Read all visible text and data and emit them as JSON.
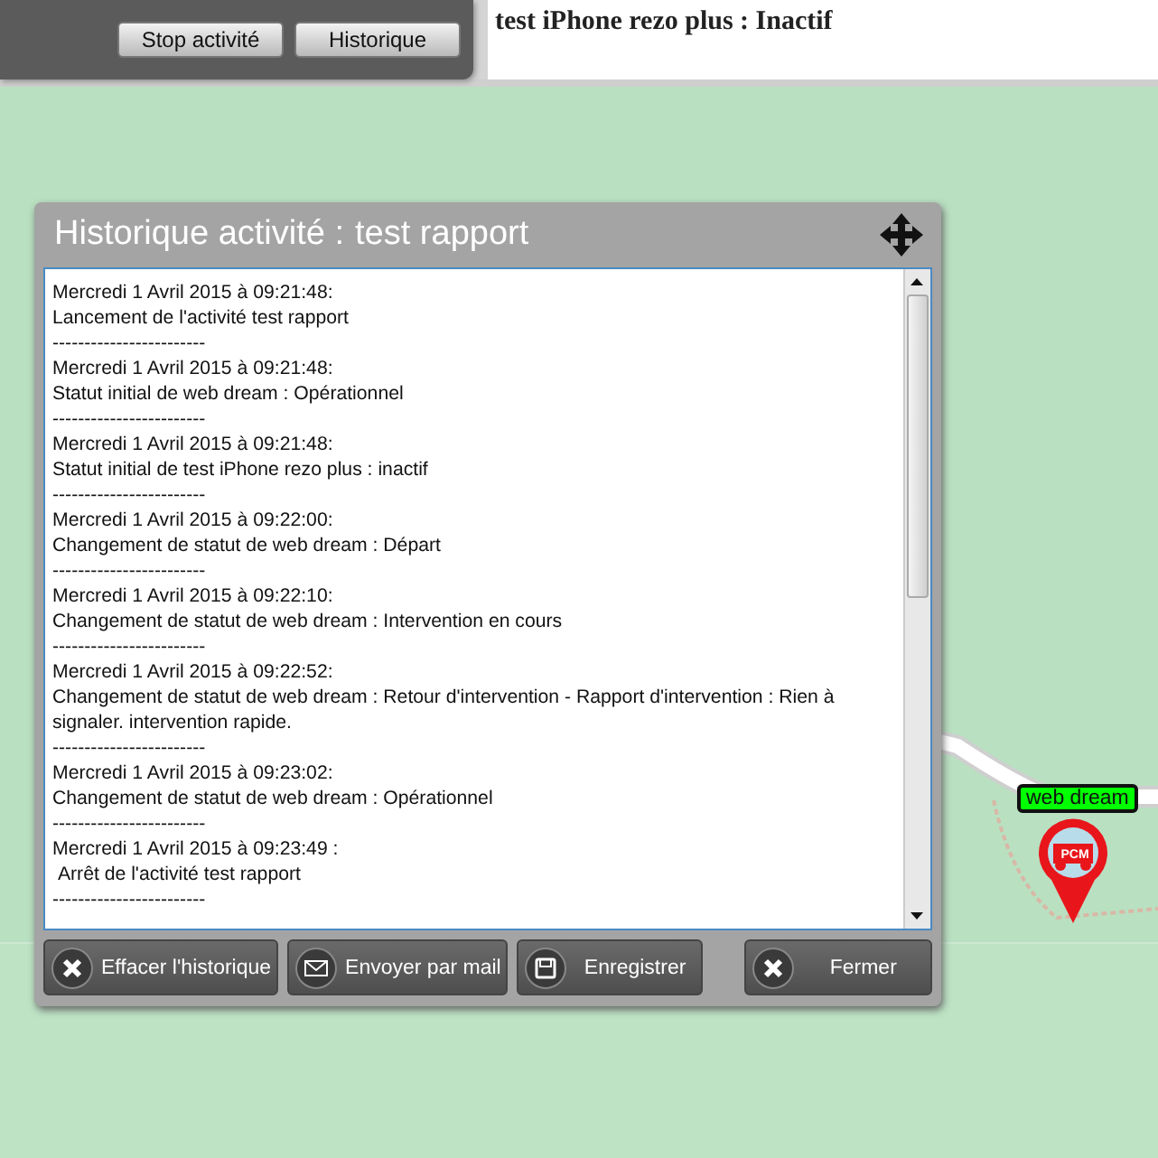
{
  "top_bar": {
    "buttons": [
      "Stop activité",
      "Historique"
    ],
    "status": "test iPhone rezo plus : Inactif"
  },
  "map": {
    "kind": "picture",
    "marker": {
      "label": "web dream",
      "badge": "PCM"
    }
  },
  "dialog": {
    "title": "Historique activité :",
    "subject": "test rapport",
    "log": [
      {
        "timestamp": "Mercredi 1 Avril 2015 à 09:21:48:",
        "message": "Lancement de l'activité test rapport",
        "separator": "------------------------"
      },
      {
        "timestamp": "Mercredi 1 Avril 2015 à 09:21:48:",
        "message": "Statut initial de web dream : Opérationnel",
        "separator": "------------------------"
      },
      {
        "timestamp": "Mercredi 1 Avril 2015 à 09:21:48:",
        "message": "Statut initial de test iPhone rezo plus : inactif",
        "separator": "------------------------"
      },
      {
        "timestamp": "Mercredi 1 Avril 2015 à 09:22:00:",
        "message": "Changement de statut de web dream : Départ",
        "separator": "------------------------"
      },
      {
        "timestamp": "Mercredi 1 Avril 2015 à 09:22:10:",
        "message": "Changement de statut de web dream : Intervention en cours",
        "separator": "------------------------"
      },
      {
        "timestamp": "Mercredi 1 Avril 2015 à 09:22:52:",
        "message": "Changement de statut de web dream : Retour d'intervention - Rapport d'intervention : Rien à signaler. intervention rapide.",
        "separator": "------------------------"
      },
      {
        "timestamp": "Mercredi 1 Avril 2015 à 09:23:02:",
        "message": "Changement de statut de web dream : Opérationnel",
        "separator": "------------------------"
      },
      {
        "timestamp": "Mercredi 1 Avril 2015 à 09:23:49 :",
        "message": " Arrêt de l'activité test rapport",
        "separator": "------------------------"
      }
    ],
    "buttons": [
      {
        "kind": "clear",
        "label": "Effacer l'historique"
      },
      {
        "kind": "mail",
        "label": "Envoyer par mail"
      },
      {
        "kind": "save",
        "label": "Enregistrer"
      },
      {
        "kind": "close",
        "label": "Fermer"
      }
    ]
  }
}
